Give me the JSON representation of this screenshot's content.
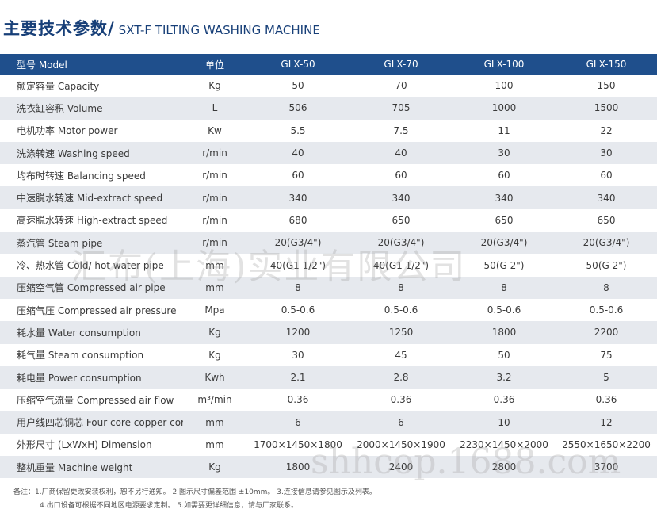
{
  "title": {
    "cn": "主要技术参数",
    "separator": "/",
    "en": "SXT-F TILTING WASHING MACHINE"
  },
  "table": {
    "header": {
      "param": "型号 Model",
      "unit": "单位",
      "models": [
        "GLX-50",
        "GLX-70",
        "GLX-100",
        "GLX-150"
      ]
    },
    "rows": [
      {
        "param": "额定容量 Capacity",
        "unit": "Kg",
        "values": [
          "50",
          "70",
          "100",
          "150"
        ]
      },
      {
        "param": "洗衣缸容积 Volume",
        "unit": "L",
        "values": [
          "506",
          "705",
          "1000",
          "1500"
        ]
      },
      {
        "param": "电机功率 Motor power",
        "unit": "Kw",
        "values": [
          "5.5",
          "7.5",
          "11",
          "22"
        ]
      },
      {
        "param": "洗涤转速 Washing speed",
        "unit": "r/min",
        "values": [
          "40",
          "40",
          "30",
          "30"
        ]
      },
      {
        "param": "均布时转速 Balancing speed",
        "unit": "r/min",
        "values": [
          "60",
          "60",
          "60",
          "60"
        ]
      },
      {
        "param": "中速脱水转速 Mid-extract speed",
        "unit": "r/min",
        "values": [
          "340",
          "340",
          "340",
          "340"
        ]
      },
      {
        "param": "高速脱水转速 High-extract speed",
        "unit": "r/min",
        "values": [
          "680",
          "650",
          "650",
          "650"
        ]
      },
      {
        "param": "蒸汽管 Steam pipe",
        "unit": "r/min",
        "values": [
          "20(G3/4\")",
          "20(G3/4\")",
          "20(G3/4\")",
          "20(G3/4\")"
        ]
      },
      {
        "param": "冷、热水管 Cold/ hot water pipe",
        "unit": "mm",
        "values": [
          "40(G1 1/2\")",
          "40(G1 1/2\")",
          "50(G 2\")",
          "50(G 2\")"
        ]
      },
      {
        "param": "压缩空气管 Compressed air pipe",
        "unit": "mm",
        "values": [
          "8",
          "8",
          "8",
          "8"
        ]
      },
      {
        "param": "压缩气压 Compressed air pressure",
        "unit": "Mpa",
        "values": [
          "0.5-0.6",
          "0.5-0.6",
          "0.5-0.6",
          "0.5-0.6"
        ]
      },
      {
        "param": "耗水量 Water consumption",
        "unit": "Kg",
        "values": [
          "1200",
          "1250",
          "1800",
          "2200"
        ]
      },
      {
        "param": "耗气量 Steam consumption",
        "unit": "Kg",
        "values": [
          "30",
          "45",
          "50",
          "75"
        ]
      },
      {
        "param": "耗电量 Power consumption",
        "unit": "Kwh",
        "values": [
          "2.1",
          "2.8",
          "3.2",
          "5"
        ]
      },
      {
        "param": "压缩空气流量 Compressed air flow",
        "unit": "m³/min",
        "values": [
          "0.36",
          "0.36",
          "0.36",
          "0.36"
        ]
      },
      {
        "param": "用户线四芯铜芯 Four core copper core",
        "unit": "mm",
        "values": [
          "6",
          "6",
          "10",
          "12"
        ]
      },
      {
        "param": "外形尺寸 (LxWxH) Dimension",
        "unit": "mm",
        "values": [
          "1700×1450×1800",
          "2000×1450×1900",
          "2230×1450×2000",
          "2550×1650×2200"
        ]
      },
      {
        "param": "整机重量 Machine weight",
        "unit": "Kg",
        "values": [
          "1800",
          "2400",
          "2800",
          "3700"
        ]
      }
    ]
  },
  "notes": {
    "line1": "备注：1.厂商保留更改安装权利，恕不另行通知。   2.图示尺寸偏差范围 ±10mm。   3.连接信息请参见图示及列表。",
    "line2": "4.出口设备可根据不同地区电源要求定制。   5.如需要更详细信息，请与厂家联系。"
  },
  "watermarks": {
    "company": "汇布(上海)实业有限公司",
    "site": "shhcop.1688.com"
  }
}
